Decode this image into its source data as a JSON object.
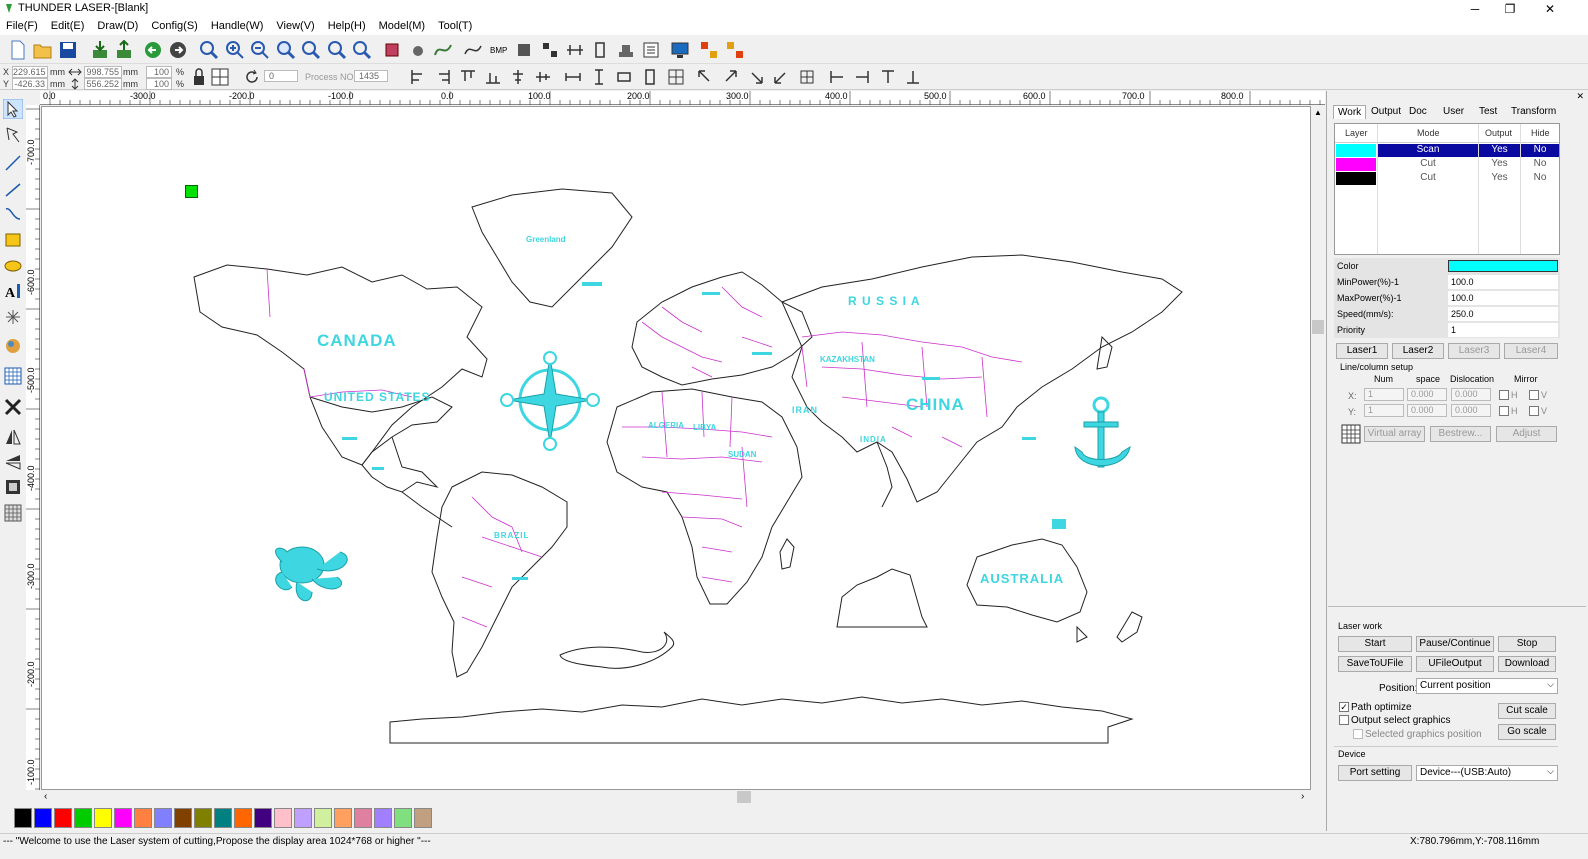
{
  "window": {
    "title": "THUNDER LASER-[Blank]"
  },
  "menu": [
    "File(F)",
    "Edit(E)",
    "Draw(D)",
    "Config(S)",
    "Handle(W)",
    "View(V)",
    "Help(H)",
    "Model(M)",
    "Tool(T)"
  ],
  "coords": {
    "x_label": "X",
    "y_label": "Y",
    "x_value": "229.615",
    "y_value": "-426.33",
    "unit": "mm",
    "width": "998.755",
    "height": "556.252",
    "scale_x": "100",
    "scale_y": "100",
    "pct": "%",
    "rotate": "0",
    "process_no_label": "Process NO:",
    "process_no": "1435"
  },
  "ruler_h": [
    "0.0",
    "-300.0",
    "-200.0",
    "-100.0",
    "0.0",
    "100.0",
    "200.0",
    "300.0",
    "400.0",
    "500.0",
    "600.0",
    "700.0",
    "800.0"
  ],
  "ruler_v": [
    "-700.0",
    "-600.0",
    "-500.0",
    "-400.0",
    "-300.0",
    "-200.0",
    "-100.0"
  ],
  "map_labels": {
    "canada": "CANADA",
    "usa": "UNITED STATES",
    "russia": "R U S S I A",
    "china": "CHINA",
    "australia": "AUSTRALIA",
    "brazil": "BRAZIL",
    "greenland": "Greenland",
    "kazakhstan": "KAZAKHSTAN",
    "iran": "IRAN",
    "india": "INDIA",
    "algeria": "ALGERIA",
    "libya": "LIBYA",
    "sudan": "SUDAN"
  },
  "panel": {
    "tabs": [
      "Work",
      "Output",
      "Doc",
      "User",
      "Test",
      "Transform"
    ],
    "layer_headers": {
      "layer": "Layer",
      "mode": "Mode",
      "output": "Output",
      "hide": "Hide"
    },
    "layers": [
      {
        "color": "#00ffff",
        "mode": "Scan",
        "output": "Yes",
        "hide": "No",
        "selected": true
      },
      {
        "color": "#ff00ff",
        "mode": "Cut",
        "output": "Yes",
        "hide": "No",
        "selected": false
      },
      {
        "color": "#000000",
        "mode": "Cut",
        "output": "Yes",
        "hide": "No",
        "selected": false
      }
    ],
    "props": {
      "color_label": "Color",
      "color_value": "#00ffff",
      "minpower_label": "MinPower(%)-1",
      "minpower": "100.0",
      "maxpower_label": "MaxPower(%)-1",
      "maxpower": "100.0",
      "speed_label": "Speed(mm/s):",
      "speed": "250.0",
      "priority_label": "Priority",
      "priority": "1"
    },
    "laser_buttons": [
      "Laser1",
      "Laser2",
      "Laser3",
      "Laser4"
    ],
    "array": {
      "title": "Line/column setup",
      "num": "Num",
      "space": "space",
      "dislocation": "Dislocation",
      "mirror": "Mirror",
      "x_label": "X:",
      "y_label": "Y:",
      "x_num": "1",
      "x_space": "0.000",
      "x_disl": "0.000",
      "y_num": "1",
      "y_space": "0.000",
      "y_disl": "0.000",
      "h": "H",
      "v": "V",
      "virtual": "Virtual array",
      "bestrew": "Bestrew...",
      "adjust": "Adjust"
    },
    "laserwork": {
      "title": "Laser work",
      "start": "Start",
      "pause": "Pause/Continue",
      "stop": "Stop",
      "save_ufile": "SaveToUFile",
      "ufile_output": "UFileOutput",
      "download": "Download",
      "position_label": "Position:",
      "position_value": "Current position",
      "path_optimize": "Path optimize",
      "output_select": "Output select graphics",
      "selected_pos": "Selected graphics position",
      "cut_scale": "Cut scale",
      "go_scale": "Go scale",
      "device_title": "Device",
      "port_setting": "Port setting",
      "device_value": "Device---(USB:Auto)"
    }
  },
  "palette": [
    "#000000",
    "#0000ff",
    "#ff0000",
    "#00cc00",
    "#ffff00",
    "#ff00ff",
    "#ff8040",
    "#8080ff",
    "#804000",
    "#808000",
    "#008080",
    "#ff6600",
    "#400080",
    "#ffc0cb",
    "#c0a0ff",
    "#d0f0a0",
    "#ffa060",
    "#e080a0",
    "#a080ff",
    "#80e080",
    "#c0a080"
  ],
  "status": {
    "message": "--- \"Welcome to use the Laser system of cutting,Propose the display area 1024*768 or higher \"---",
    "coords": "X:780.796mm,Y:-708.116mm"
  }
}
